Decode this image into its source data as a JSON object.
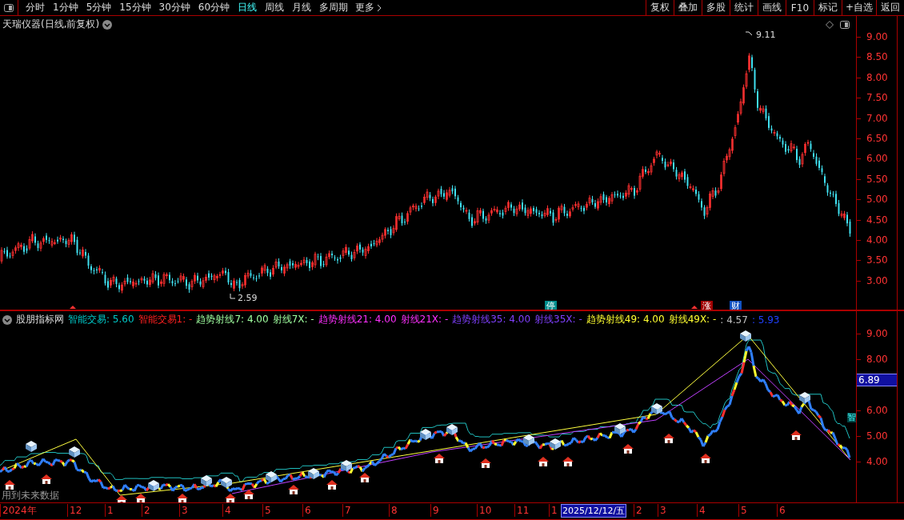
{
  "toolbar": {
    "periods": [
      {
        "label": "分时",
        "selected": false
      },
      {
        "label": "1分钟",
        "selected": false
      },
      {
        "label": "5分钟",
        "selected": false
      },
      {
        "label": "15分钟",
        "selected": false
      },
      {
        "label": "30分钟",
        "selected": false
      },
      {
        "label": "60分钟",
        "selected": false
      },
      {
        "label": "日线",
        "selected": true
      },
      {
        "label": "周线",
        "selected": false
      },
      {
        "label": "月线",
        "selected": false
      },
      {
        "label": "多周期",
        "selected": false
      }
    ],
    "more": "更多",
    "buttons": [
      "复权",
      "叠加",
      "多股",
      "统计",
      "画线",
      "F10",
      "标记",
      "+自选",
      "返回"
    ]
  },
  "price_chart": {
    "title": "天瑞仪器(日线,前复权)",
    "axis_labels": [
      "9.00",
      "8.50",
      "8.00",
      "7.50",
      "7.00",
      "6.50",
      "6.00",
      "5.50",
      "5.00",
      "4.50",
      "4.00",
      "3.50",
      "3.00"
    ],
    "high_label": "9.11",
    "low_label": "2.59",
    "badges": [
      {
        "label": "停",
        "color": "#008c8c"
      },
      {
        "label": "涨",
        "color": "#a00000"
      },
      {
        "label": "财",
        "color": "#1050c0"
      }
    ]
  },
  "indicator": {
    "name": "股朋指标网",
    "legend": [
      {
        "text": "智能交易: 5.60",
        "color": "#00c8c8"
      },
      {
        "text": "智能交易1: -",
        "color": "#ff2020"
      },
      {
        "text": "趋势射线7: 4.00",
        "color": "#a0ffa0"
      },
      {
        "text": "射线7X: -",
        "color": "#a0ffa0"
      },
      {
        "text": "趋势射线21: 4.00",
        "color": "#ff30ff"
      },
      {
        "text": "射线21X: -",
        "color": "#ff30ff"
      },
      {
        "text": "趋势射线35: 4.00",
        "color": "#8040ff"
      },
      {
        "text": "射线35X: -",
        "color": "#8040ff"
      },
      {
        "text": "趋势射线49: 4.00",
        "color": "#ffff30"
      },
      {
        "text": "射线49X: -",
        "color": "#ffff30"
      },
      {
        "text": ": 4.57",
        "color": "#c0c0c0"
      },
      {
        "text": ": 5.93",
        "color": "#2040ff"
      }
    ],
    "axis_labels": [
      "9.00",
      "8.00",
      "6.00",
      "5.00",
      "4.00"
    ],
    "current_value": "6.89",
    "side_label": "智",
    "note": "用到未来数据"
  },
  "time_axis": {
    "labels": [
      {
        "label": "2024年",
        "selected": false
      },
      {
        "label": "12",
        "selected": false
      },
      {
        "label": "1",
        "selected": false
      },
      {
        "label": "2",
        "selected": false
      },
      {
        "label": "3",
        "selected": false
      },
      {
        "label": "4",
        "selected": false
      },
      {
        "label": "5",
        "selected": false
      },
      {
        "label": "6",
        "selected": false
      },
      {
        "label": "7",
        "selected": false
      },
      {
        "label": "8",
        "selected": false
      },
      {
        "label": "9",
        "selected": false
      },
      {
        "label": "10",
        "selected": false
      },
      {
        "label": "11",
        "selected": false
      },
      {
        "label": "1",
        "selected": false
      },
      {
        "label": "2025/12/12/五",
        "selected": true
      },
      {
        "label": "2",
        "selected": false
      },
      {
        "label": "3",
        "selected": false
      },
      {
        "label": "4",
        "selected": false
      },
      {
        "label": "5",
        "selected": false
      },
      {
        "label": "6",
        "selected": false
      }
    ]
  }
}
